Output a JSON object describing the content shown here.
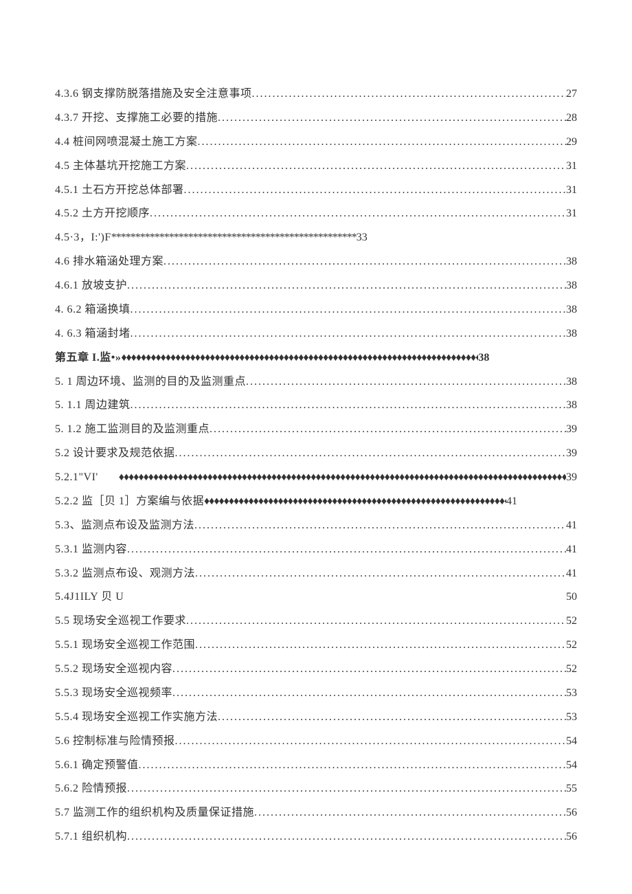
{
  "toc": [
    {
      "label": "4.3.6 钢支撑防脱落措施及安全注意事项 ",
      "page": "27",
      "leader": "dots"
    },
    {
      "label": "4.3.7 开挖、支撑施工必要的措施 ",
      "page": "28",
      "leader": "dots"
    },
    {
      "label": "4.4 桩间网喷混凝土施工方案",
      "page": "29",
      "leader": "dots"
    },
    {
      "label": "4.5 主体基坑开挖施工方案",
      "page": "31",
      "leader": "dots"
    },
    {
      "label": "4.5.1 土石方开挖总体部署 ",
      "page": "31",
      "leader": "dots"
    },
    {
      "label": "4.5.2 土方开挖顺序 ",
      "page": "31",
      "leader": "dots"
    },
    {
      "label": "4.5·3，I:')F",
      "page": "33",
      "leader": "stars",
      "stars": "***************************************************"
    },
    {
      "label": "4.6 排水箱涵处理方案",
      "page": "38",
      "leader": "dots"
    },
    {
      "label": "4.6.1 放坡支护 ",
      "page": "38",
      "leader": "dots"
    },
    {
      "label": "4. 6.2 箱涵换填 ",
      "page": "38",
      "leader": "dots"
    },
    {
      "label": "4. 6.3 箱涵封堵 ",
      "page": "38",
      "leader": "dots"
    },
    {
      "label": "第五章 I.监•»",
      "page": "38",
      "leader": "diamonds",
      "bold": true,
      "diamondsWidth": 520
    },
    {
      "label": "5. 1 周边环境、监测的目的及监测重点",
      "page": "38",
      "leader": "dots"
    },
    {
      "label": "5. 1.1 周边建筑 ",
      "page": "38",
      "leader": "dots"
    },
    {
      "label": "5. 1.2 施工监测目的及监测重点 ",
      "page": "39",
      "leader": "dots"
    },
    {
      "label": "5.2 设计要求及规范依据",
      "page": "39",
      "leader": "dots"
    },
    {
      "label": "5.2.1\"VI'",
      "page": "39",
      "leader": "diamonds",
      "gap": true
    },
    {
      "label": "5.2.2 监［贝 1］方案编与依据",
      "page": "41",
      "leader": "diamonds",
      "diamondsWidth": 440
    },
    {
      "label": "5.3、监测点布设及监测方法 ",
      "page": "41",
      "leader": "dots"
    },
    {
      "label": "5.3.1 监测内容 ",
      "page": "41",
      "leader": "dots"
    },
    {
      "label": "5.3.2 监测点布设、观测方法 ",
      "page": "41",
      "leader": "dots"
    },
    {
      "label": "5.4J1ILY 贝 U",
      "page": "50",
      "leader": "none"
    },
    {
      "label": "5.5 现场安全巡视工作要求",
      "page": "52",
      "leader": "dots"
    },
    {
      "label": "5.5.1 现场安全巡视工作范围 ",
      "page": "52",
      "leader": "dots"
    },
    {
      "label": "5.5.2 现场安全巡视内容 ",
      "page": "52",
      "leader": "dots"
    },
    {
      "label": "5.5.3 现场安全巡视频率 ",
      "page": "53",
      "leader": "dots"
    },
    {
      "label": "5.5.4 现场安全巡视工作实施方法 ",
      "page": "53",
      "leader": "dots"
    },
    {
      "label": "5.6 控制标准与险情预报",
      "page": "54",
      "leader": "dots"
    },
    {
      "label": "5.6.1 确定预警值 ",
      "page": "54",
      "leader": "dots"
    },
    {
      "label": "5.6.2 险情预报 ",
      "page": "55",
      "leader": "dots"
    },
    {
      "label": "5.7 监测工作的组织机构及质量保证措施",
      "page": "56",
      "leader": "dots"
    },
    {
      "label": "5.7.1 组织机构 ",
      "page": "56",
      "leader": "dots"
    }
  ]
}
